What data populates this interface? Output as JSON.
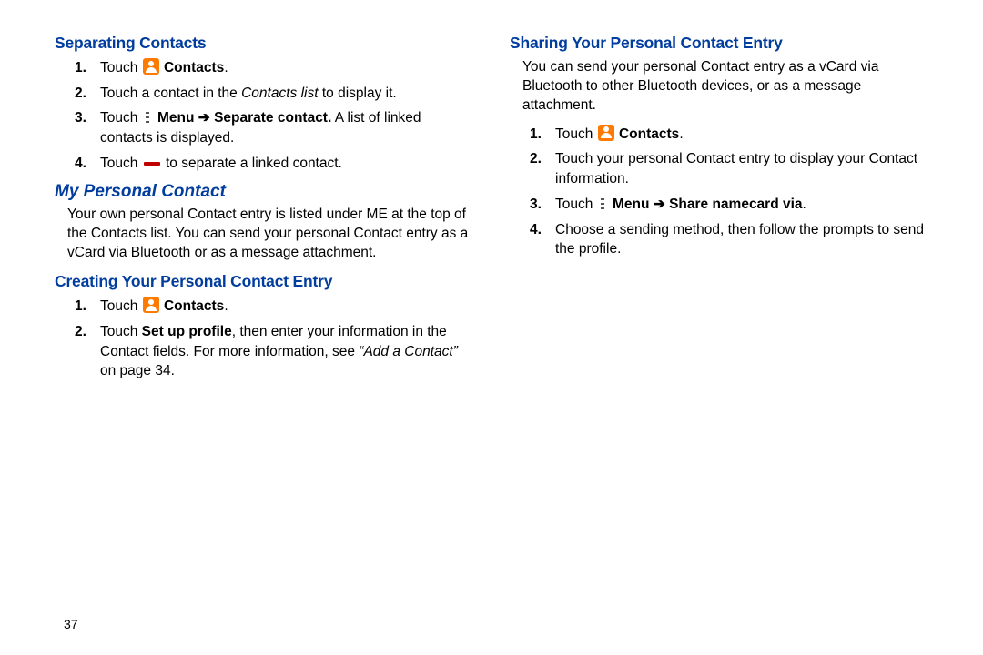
{
  "pageNumber": "37",
  "left": {
    "separating": {
      "heading": "Separating Contacts",
      "step1_a": "Touch ",
      "step1_b": "Contacts",
      "step1_c": ".",
      "step2_a": "Touch a contact in the ",
      "step2_b": "Contacts list ",
      "step2_c": "to display it.",
      "step3_a": "Touch ",
      "step3_b": "Menu ",
      "step3_arrow": "➔ ",
      "step3_c": "Separate contact.",
      "step3_d": " A list of linked contacts is displayed.",
      "step4_a": "Touch ",
      "step4_b": " to separate a linked contact."
    },
    "myPersonal": {
      "heading": "My Personal Contact",
      "intro": "Your own personal Contact entry is listed under ME at the top of the Contacts list. You can send your personal Contact entry as a vCard via Bluetooth or as a message attachment."
    },
    "creating": {
      "heading": "Creating Your Personal Contact Entry",
      "step1_a": "Touch ",
      "step1_b": "Contacts",
      "step1_c": ".",
      "step2_a": "Touch ",
      "step2_b": "Set up profile",
      "step2_c": ", then enter your information in the Contact fields. For more information, see ",
      "step2_d": "“Add a Contact” ",
      "step2_e": "on page 34."
    }
  },
  "right": {
    "sharing": {
      "heading": "Sharing Your Personal Contact Entry",
      "intro": "You can send your personal Contact entry as a vCard via Bluetooth to other Bluetooth devices, or as a message attachment.",
      "step1_a": "Touch ",
      "step1_b": "Contacts",
      "step1_c": ".",
      "step2": "Touch your personal Contact entry to display your Contact information.",
      "step3_a": "Touch ",
      "step3_b": "Menu ",
      "step3_arrow": "➔ ",
      "step3_c": "Share namecard via",
      "step3_d": ".",
      "step4": "Choose a sending method, then follow the prompts to send the profile."
    }
  }
}
